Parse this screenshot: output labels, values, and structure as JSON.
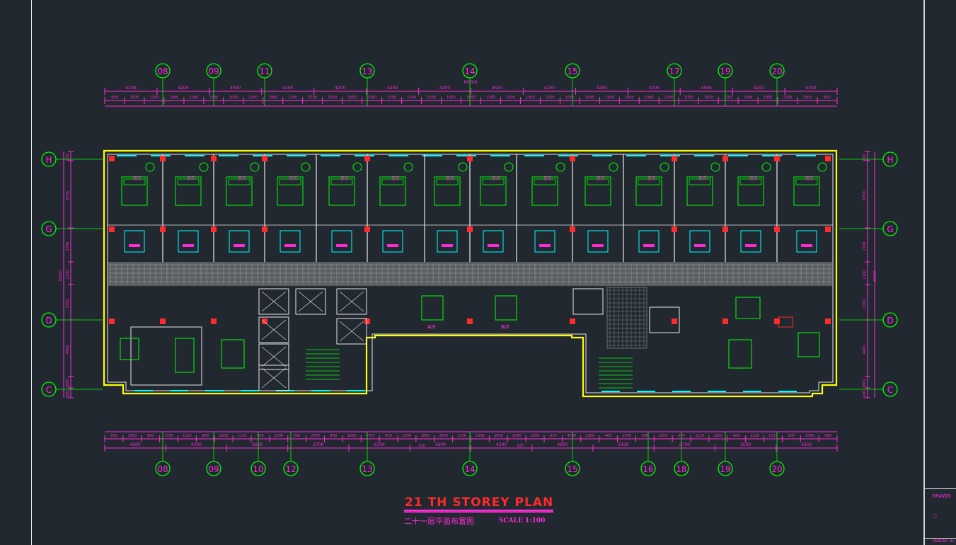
{
  "drawing": {
    "title": "21 TH  STOREY  PLAN",
    "subtitle": "二十一层平面布置图",
    "scale": "SCALE  1:100",
    "title_block_label": "DRAWIN",
    "title_block_sub": "二",
    "title_block_foot": "DRAWING No"
  },
  "axes_top": [
    "08",
    "09",
    "11",
    "13",
    "14",
    "15",
    "17",
    "19",
    "20"
  ],
  "axes_bottom": [
    "08",
    "09",
    "10",
    "12",
    "13",
    "14",
    "15",
    "16",
    "18",
    "19",
    "20"
  ],
  "axes_left": [
    "H",
    "G",
    "D",
    "C"
  ],
  "axes_right": [
    "H",
    "G",
    "D",
    "C"
  ],
  "dims_top_row1": [
    "4200",
    "4200",
    "4500",
    "4200",
    "4200",
    "4200",
    "4200",
    "4500",
    "4200",
    "4200",
    "4200",
    "4500",
    "4200",
    "4200"
  ],
  "dims_top_total": "60000",
  "dims_top_row2": [
    "600",
    "1000",
    "2200",
    "1000",
    "1000",
    "2200",
    "1000",
    "2200",
    "1000",
    "1000",
    "2200",
    "1000",
    "1000",
    "2200",
    "1000",
    "1000",
    "2200",
    "1000",
    "1000",
    "2200",
    "1000",
    "1000",
    "2200",
    "1000",
    "1000",
    "2200",
    "1000",
    "1000",
    "2200",
    "1000",
    "1000",
    "2200",
    "1000",
    "1000",
    "2200",
    "1000",
    "600"
  ],
  "dims_bottom_row1": [
    "600",
    "1050",
    "900",
    "1150",
    "1120",
    "900",
    "2200",
    "1120",
    "900",
    "2200",
    "500",
    "2700",
    "400",
    "1200",
    "4700",
    "820",
    "2200",
    "1060",
    "2956",
    "1236",
    "1236",
    "2956",
    "1060",
    "2200",
    "820",
    "4700",
    "1200",
    "400",
    "2700",
    "500",
    "2200",
    "900",
    "1120",
    "2200",
    "900",
    "1120",
    "1150",
    "900",
    "1050",
    "600"
  ],
  "dims_bottom_mid": [
    "520",
    "520"
  ],
  "dims_bottom_row2": [
    "4200",
    "4200",
    "3600",
    "2700",
    "6300",
    "4200",
    "4200",
    "4200",
    "6300",
    "2700",
    "3600",
    "4200"
  ],
  "dims_left": [
    "600",
    "5700",
    "2700",
    "2100",
    "2700",
    "4400",
    "1800",
    "600"
  ],
  "dims_left_total": "20100",
  "dims_right": [
    "600",
    "5700",
    "2700",
    "2100",
    "2700",
    "4400",
    "1800",
    "600"
  ],
  "dims_right_total": "20100",
  "room_label": "客房",
  "colors": {
    "background": "#212830",
    "axis_bubble": "#00ff00",
    "axis_text": "#ff2bd6",
    "dimension": "#ff2bd6",
    "wall": "#ffff00",
    "window": "#00ffff",
    "column": "#ff2a2a",
    "furniture": "#00ff00",
    "fixture": "#ff2bd6",
    "corridor": "#8a8a8a",
    "title": "#ff2a2a"
  }
}
